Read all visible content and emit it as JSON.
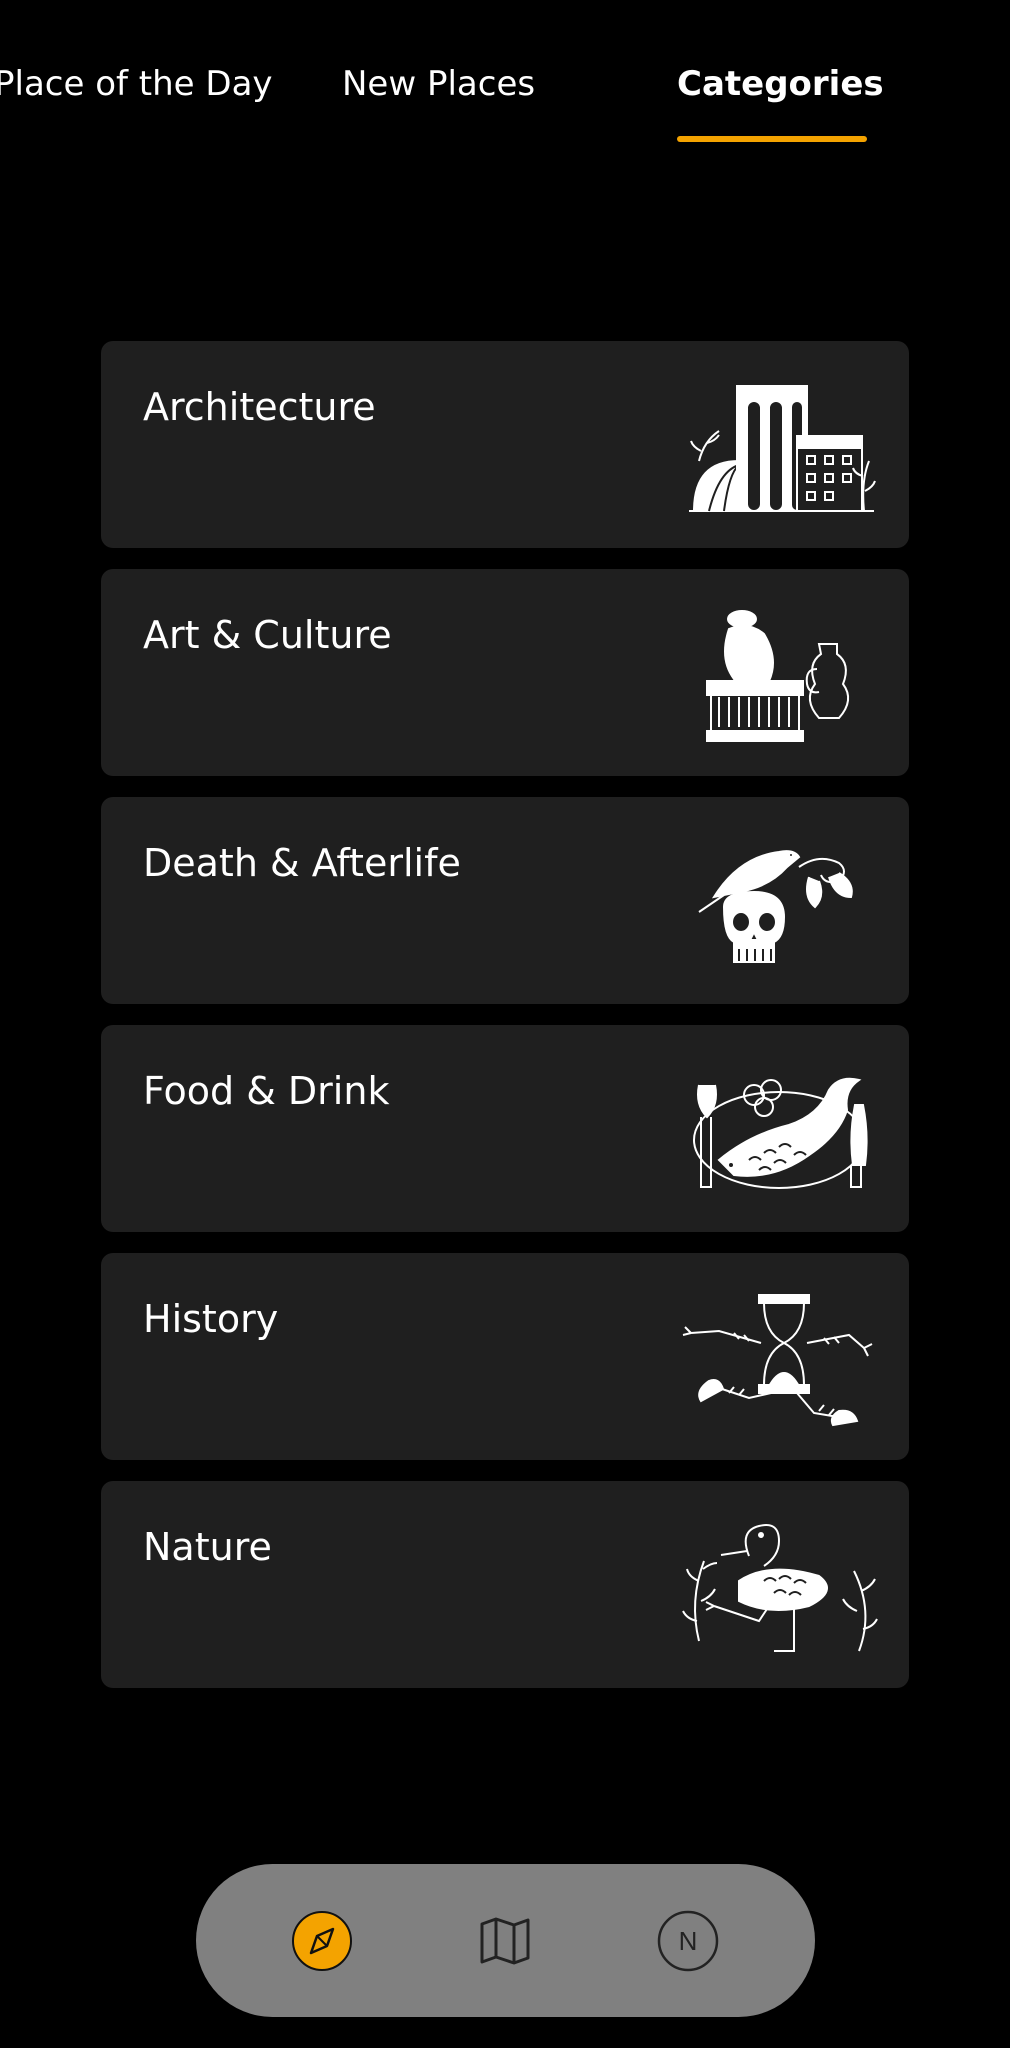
{
  "tabs": [
    {
      "label": "Place of the Day"
    },
    {
      "label": "New Places"
    },
    {
      "label": "Categories"
    }
  ],
  "categories": [
    {
      "label": "Architecture",
      "icon": "architecture-illustration"
    },
    {
      "label": "Art & Culture",
      "icon": "art-culture-illustration"
    },
    {
      "label": "Death & Afterlife",
      "icon": "death-afterlife-illustration"
    },
    {
      "label": "Food & Drink",
      "icon": "food-drink-illustration"
    },
    {
      "label": "History",
      "icon": "history-illustration"
    },
    {
      "label": "Nature",
      "icon": "nature-illustration"
    }
  ],
  "bottom_nav": {
    "explore_icon": "compass-icon",
    "map_icon": "map-icon",
    "profile_letter": "N"
  },
  "colors": {
    "accent": "#f4a300",
    "card_bg": "#1f1f1f",
    "nav_bg": "#808080"
  }
}
